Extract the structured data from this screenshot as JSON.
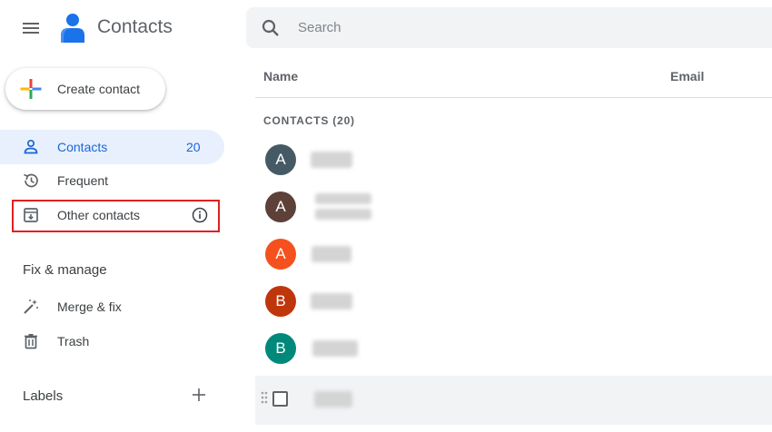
{
  "app": {
    "title": "Contacts"
  },
  "search": {
    "placeholder": "Search"
  },
  "sidebar": {
    "create_label": "Create contact",
    "items": [
      {
        "label": "Contacts",
        "count": "20",
        "icon": "person-icon",
        "active": true
      },
      {
        "label": "Frequent",
        "icon": "history-icon"
      },
      {
        "label": "Other contacts",
        "icon": "archive-icon",
        "trailing_icon": "info-icon"
      }
    ],
    "fix_heading": "Fix & manage",
    "fix_items": [
      {
        "label": "Merge & fix",
        "icon": "magic-wand-icon"
      },
      {
        "label": "Trash",
        "icon": "trash-icon"
      }
    ],
    "labels_heading": "Labels"
  },
  "list": {
    "columns": {
      "name": "Name",
      "email": "Email"
    },
    "section_label": "CONTACTS (20)",
    "rows": [
      {
        "initial": "A",
        "color": "#455a64"
      },
      {
        "initial": "A",
        "color": "#5d4037"
      },
      {
        "initial": "A",
        "color": "#f4511e"
      },
      {
        "initial": "B",
        "color": "#bf360c"
      },
      {
        "initial": "B",
        "color": "#00897b"
      },
      {
        "initial": "",
        "selectable": true
      }
    ]
  },
  "colors": {
    "accent": "#1967d2",
    "active_bg": "#e8f0fe",
    "highlight": "#e02020"
  }
}
